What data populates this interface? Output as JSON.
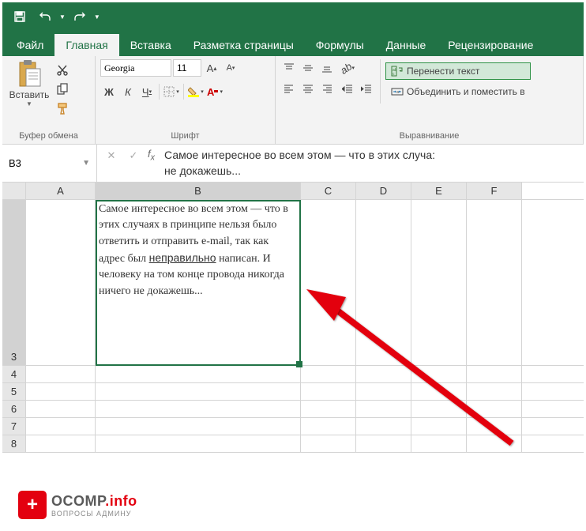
{
  "titlebar": {
    "save": "save",
    "undo": "undo",
    "redo": "redo"
  },
  "tabs": {
    "file": "Файл",
    "home": "Главная",
    "insert": "Вставка",
    "layout": "Разметка страницы",
    "formulas": "Формулы",
    "data": "Данные",
    "review": "Рецензирование"
  },
  "ribbon": {
    "clipboard": {
      "paste": "Вставить",
      "label": "Буфер обмена"
    },
    "font": {
      "name": "Georgia",
      "size": "11",
      "label": "Шрифт",
      "bold": "Ж",
      "italic": "К",
      "underline": "Ч"
    },
    "alignment": {
      "label": "Выравнивание",
      "wrap": "Перенести текст",
      "merge": "Объединить и поместить в"
    }
  },
  "namebox": "B3",
  "formula_text": "Самое интересное во всем этом — что в этих случаях в принципе нельзя было ответить и отправить e-mail, так как адрес был неправильно написан. И человеку на том конце провода никогда ничего не докажешь...",
  "columns": [
    "A",
    "B",
    "C",
    "D",
    "E",
    "F"
  ],
  "rows": [
    "3",
    "4",
    "5",
    "6",
    "7",
    "8"
  ],
  "cell_b3_html": "Самое интересное во всем этом — что в этих случаях в принципе нельзя было ответить и отправить e-mail, так как адрес был <u>неправильно</u> написан. И человеку на том конце провода никогда ничего не докажешь...",
  "watermark": {
    "plus": "+",
    "main1": "OCOMP",
    "main2": ".info",
    "sub": "ВОПРОСЫ АДМИНУ"
  }
}
